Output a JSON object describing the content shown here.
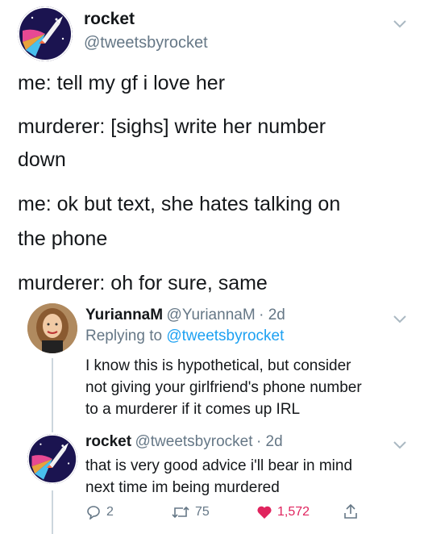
{
  "main_tweet": {
    "name": "rocket",
    "handle": "@tweetsbyrocket",
    "lines": [
      "me: tell my gf i love her",
      "murderer: [sighs] write her number",
      "down",
      "me: ok but text, she hates talking on",
      "the phone",
      "murderer: oh for sure, same"
    ]
  },
  "reply_1": {
    "name": "YuriannaM",
    "handle": "@YuriannaM",
    "time": "· 2d",
    "replying_prefix": "Replying to",
    "replying_handle": "@tweetsbyrocket",
    "lines": [
      "I know this is hypothetical, but consider",
      "not giving your girlfriend's phone number",
      "to a murderer if it comes up IRL"
    ]
  },
  "reply_2": {
    "name": "rocket",
    "handle": "@tweetsbyrocket",
    "time": "· 2d",
    "lines": [
      "that is very good advice i'll bear in mind",
      "next time im being murdered"
    ],
    "actions": {
      "replies": "2",
      "retweets": "75",
      "likes": "1,572"
    }
  },
  "colors": {
    "like": "#e0245e",
    "link": "#1da1f2",
    "muted": "#657786"
  }
}
